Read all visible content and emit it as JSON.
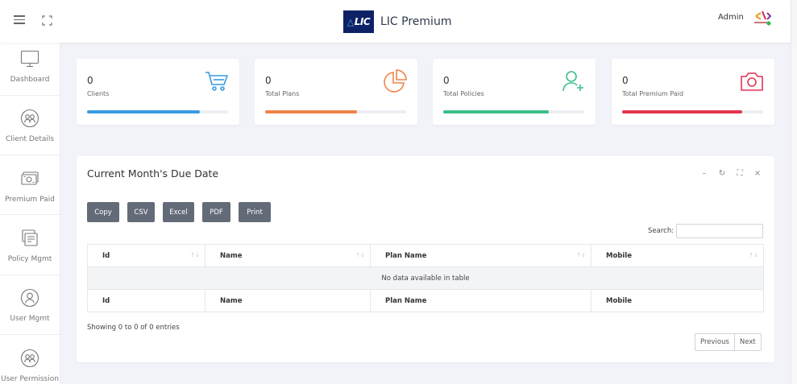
{
  "header": {
    "brand_logo_text": "LIC",
    "title": "LIC Premium",
    "user_label": "Admin"
  },
  "sidebar": {
    "items": [
      {
        "label": "Dashboard",
        "icon": "monitor-icon"
      },
      {
        "label": "Client Details",
        "icon": "people-icon"
      },
      {
        "label": "Premium Paid",
        "icon": "cash-icon"
      },
      {
        "label": "Policy Mgmt",
        "icon": "documents-icon"
      },
      {
        "label": "User Mgmt",
        "icon": "user-icon"
      },
      {
        "label": "User Permission",
        "icon": "people-icon"
      }
    ]
  },
  "stats": [
    {
      "value": "0",
      "label": "Clients",
      "icon": "cart-icon",
      "color": "#3a9be0",
      "progress": 0.8
    },
    {
      "value": "0",
      "label": "Total Plans",
      "icon": "pie-chart-icon",
      "color": "#ee8446",
      "progress": 0.65
    },
    {
      "value": "0",
      "label": "Total Policies",
      "icon": "add-user-icon",
      "color": "#3cbf86",
      "progress": 0.75
    },
    {
      "value": "0",
      "label": "Total Premium Paid",
      "icon": "camera-icon",
      "color": "#e4344e",
      "progress": 0.85
    }
  ],
  "panel": {
    "title": "Current Month's Due Date",
    "export_buttons": [
      "Copy",
      "CSV",
      "Excel",
      "PDF",
      "Print"
    ],
    "search_label": "Search:",
    "search_value": "",
    "columns": [
      "Id",
      "Name",
      "Plan Name",
      "Mobile"
    ],
    "empty_message": "No data available in table",
    "info": "Showing 0 to 0 of 0 entries",
    "pager": {
      "previous": "Previous",
      "next": "Next"
    }
  }
}
